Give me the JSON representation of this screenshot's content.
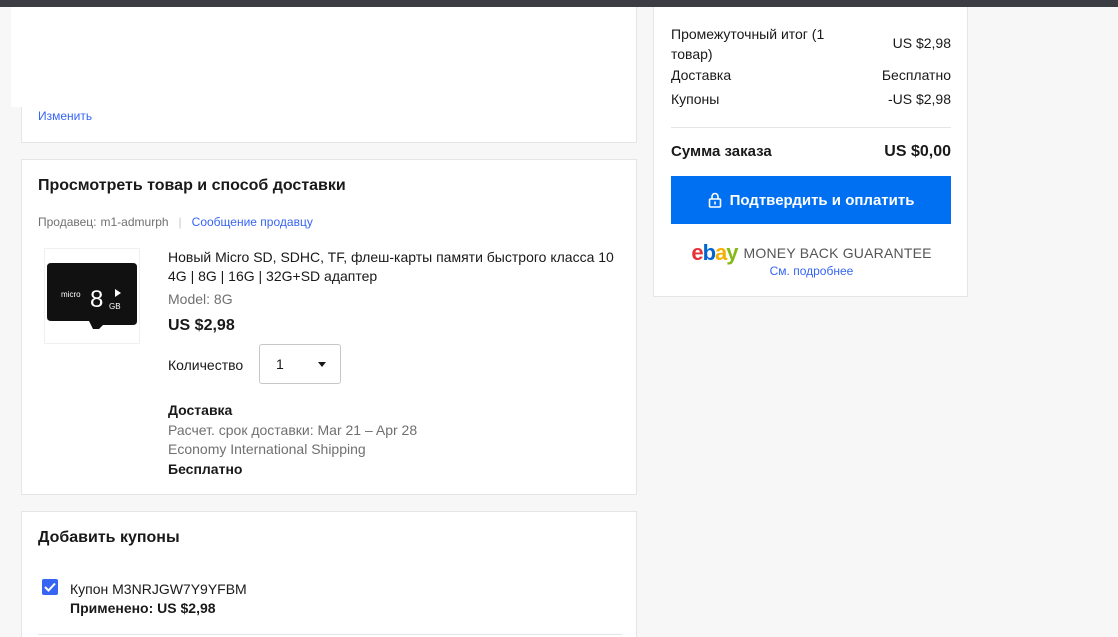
{
  "address": {
    "edit_link": "Изменить"
  },
  "review": {
    "title": "Просмотреть товар и способ доставки",
    "seller_label": "Продавец:",
    "seller_name": "m1-admurph",
    "contact_seller": "Сообщение продавцу",
    "item": {
      "image_text_brand": "micro",
      "image_text_size": "8",
      "image_text_unit": "GB",
      "title": "Новый Micro SD, SDHC, TF, флеш-карты памяти быстрого класса 10 4G | 8G | 16G | 32G+SD адаптер",
      "model": "Model: 8G",
      "price": "US $2,98",
      "quantity_label": "Количество",
      "quantity_value": "1"
    },
    "shipping": {
      "label": "Доставка",
      "estimate": "Расчет. срок доставки: Mar 21 – Apr 28",
      "method": "Economy International Shipping",
      "cost": "Бесплатно"
    }
  },
  "coupons": {
    "title": "Добавить купоны",
    "coupon_name": "Купон M3NRJGW7Y9YFBM",
    "applied_label": "Применено:",
    "applied_value": "US $2,98"
  },
  "summary": {
    "subtotal_label": "Промежуточный итог (1 товар)",
    "subtotal_value": "US $2,98",
    "shipping_label": "Доставка",
    "shipping_value": "Бесплатно",
    "coupons_label": "Купоны",
    "coupons_value": "-US $2,98",
    "total_label": "Сумма заказа",
    "total_value": "US $0,00",
    "pay_button": "Подтвердить и оплатить",
    "guarantee": "MONEY BACK GUARANTEE",
    "learn_more": "См. подробнее"
  },
  "colors": {
    "primary_button": "#0070f3",
    "link": "#3665f3"
  }
}
